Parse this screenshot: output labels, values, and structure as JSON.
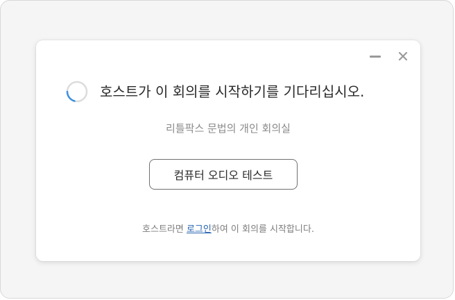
{
  "dialog": {
    "headline": "호스트가 이 회의를 시작하기를 기다리십시오.",
    "meeting_name": "리틀팍스 문법의 개인 회의실",
    "test_audio_button": "컴퓨터 오디오 테스트",
    "host_prompt_before": "호스트라면 ",
    "login_link": "로그인",
    "host_prompt_after": "하여 이 회의를 시작합니다."
  },
  "window_controls": {
    "minimize_icon": "minimize-icon",
    "close_icon": "close-icon"
  },
  "colors": {
    "link": "#2563b0",
    "spinner_track": "#dcdcdc",
    "spinner_arc": "#3d8fe0"
  }
}
